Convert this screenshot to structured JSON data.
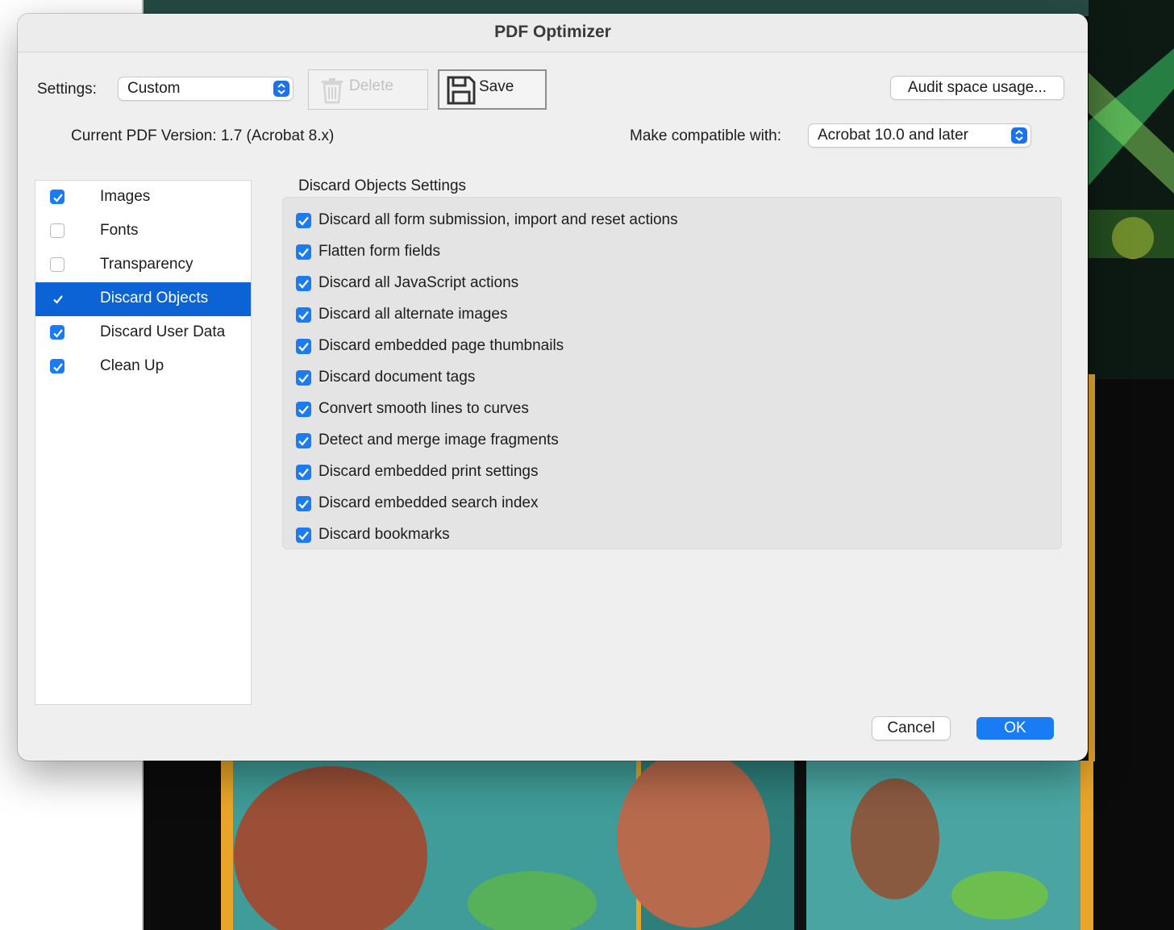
{
  "dialog": {
    "title": "PDF Optimizer",
    "settings_label": "Settings:",
    "settings_value": "Custom",
    "delete_label": "Delete",
    "save_label": "Save",
    "audit_label": "Audit space usage...",
    "current_version": "Current PDF Version: 1.7 (Acrobat 8.x)",
    "compat_label": "Make compatible with:",
    "compat_value": "Acrobat 10.0 and later"
  },
  "sidebar": {
    "items": [
      {
        "label": "Images",
        "checked": true,
        "selected": false
      },
      {
        "label": "Fonts",
        "checked": false,
        "selected": false
      },
      {
        "label": "Transparency",
        "checked": false,
        "selected": false
      },
      {
        "label": "Discard Objects",
        "checked": true,
        "selected": true
      },
      {
        "label": "Discard User Data",
        "checked": true,
        "selected": false
      },
      {
        "label": "Clean Up",
        "checked": true,
        "selected": false
      }
    ]
  },
  "panel": {
    "title": "Discard Objects Settings",
    "options": [
      {
        "label": "Discard all form submission, import and reset actions",
        "checked": true
      },
      {
        "label": "Flatten form fields",
        "checked": true
      },
      {
        "label": "Discard all JavaScript actions",
        "checked": true
      },
      {
        "label": "Discard all alternate images",
        "checked": true
      },
      {
        "label": "Discard embedded page thumbnails",
        "checked": true
      },
      {
        "label": "Discard document tags",
        "checked": true
      },
      {
        "label": "Convert smooth lines to curves",
        "checked": true
      },
      {
        "label": "Detect and merge image fragments",
        "checked": true
      },
      {
        "label": "Discard embedded print settings",
        "checked": true
      },
      {
        "label": "Discard embedded search index",
        "checked": true
      },
      {
        "label": "Discard bookmarks",
        "checked": true
      }
    ]
  },
  "footer": {
    "cancel_label": "Cancel",
    "ok_label": "OK"
  },
  "colors": {
    "accent": "#1a7cf5",
    "selection": "#0b63d6"
  }
}
